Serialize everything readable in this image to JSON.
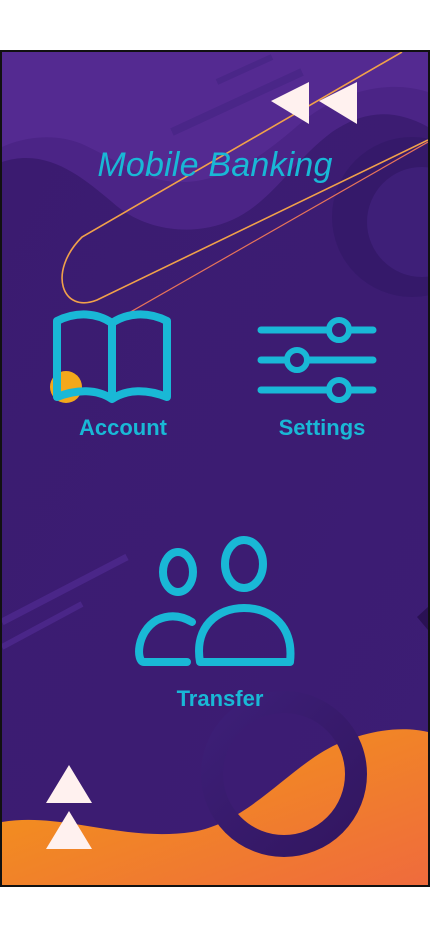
{
  "app": {
    "title": "Mobile Banking"
  },
  "menu": {
    "account_label": "Account",
    "settings_label": "Settings",
    "transfer_label": "Transfer"
  },
  "icons": {
    "account": "open-book-icon",
    "settings": "sliders-icon",
    "transfer": "users-icon",
    "back": "double-triangle-left-icon",
    "up": "double-triangle-up-icon"
  },
  "colors": {
    "background": "#3a1a6e",
    "accent": "#19b8d6",
    "orange": "#f39a1a",
    "highlight": "#fff1ef"
  }
}
